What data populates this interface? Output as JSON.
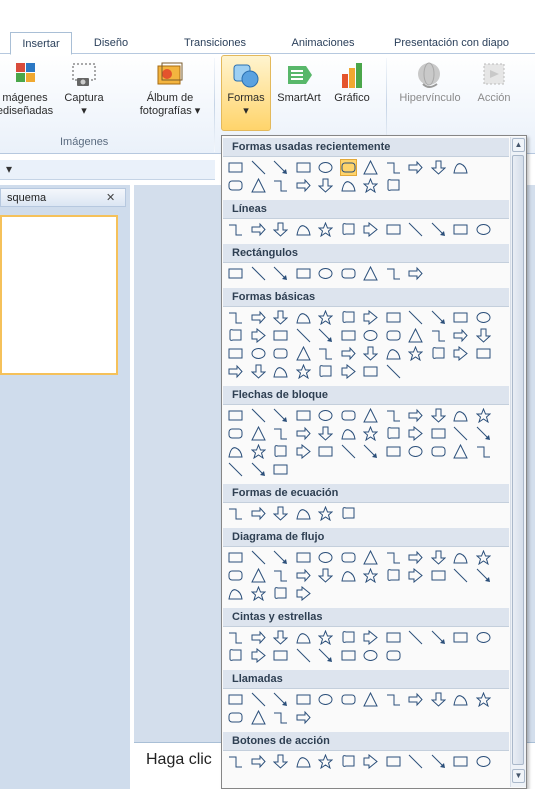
{
  "tabs": [
    {
      "label": "Insertar",
      "active": true
    },
    {
      "label": "Diseño"
    },
    {
      "label": "Transiciones"
    },
    {
      "label": "Animaciones"
    },
    {
      "label": "Presentación con diapo"
    }
  ],
  "ribbon": {
    "buttons": [
      {
        "label": "mágenes\nediseñadas",
        "icon": "clipart-icon"
      },
      {
        "label": "Captura\n▾",
        "icon": "screenshot-icon"
      },
      {
        "label": "Álbum de\nfotografías ▾",
        "icon": "photo-album-icon"
      },
      {
        "label": "Formas\n▾",
        "icon": "shapes-icon"
      },
      {
        "label": "SmartArt",
        "icon": "smartart-icon"
      },
      {
        "label": "Gráfico",
        "icon": "chart-icon"
      },
      {
        "label": "Hipervínculo",
        "icon": "hyperlink-icon"
      },
      {
        "label": "Acción",
        "icon": "action-icon"
      }
    ],
    "group_label": "Imágenes"
  },
  "left_pane": {
    "tab_label": "squema",
    "close_glyph": "✕"
  },
  "notes_text": "Haga clic",
  "dropdown": {
    "sections": [
      {
        "title": "Formas usadas recientemente",
        "rows": [
          11,
          8
        ]
      },
      {
        "title": "Líneas",
        "rows": [
          12
        ]
      },
      {
        "title": "Rectángulos",
        "rows": [
          9
        ]
      },
      {
        "title": "Formas básicas",
        "rows": [
          12,
          12,
          12,
          8
        ]
      },
      {
        "title": "Flechas de bloque",
        "rows": [
          12,
          12,
          12,
          3
        ]
      },
      {
        "title": "Formas de ecuación",
        "rows": [
          6
        ]
      },
      {
        "title": "Diagrama de flujo",
        "rows": [
          12,
          12,
          4
        ]
      },
      {
        "title": "Cintas y estrellas",
        "rows": [
          12,
          8
        ]
      },
      {
        "title": "Llamadas",
        "rows": [
          12,
          4
        ]
      },
      {
        "title": "Botones de acción",
        "rows": [
          12
        ]
      }
    ]
  },
  "colors": {
    "accent": "#ffd46b",
    "shape_stroke": "#2b4f7a",
    "section_bg": "#dde4ee"
  }
}
